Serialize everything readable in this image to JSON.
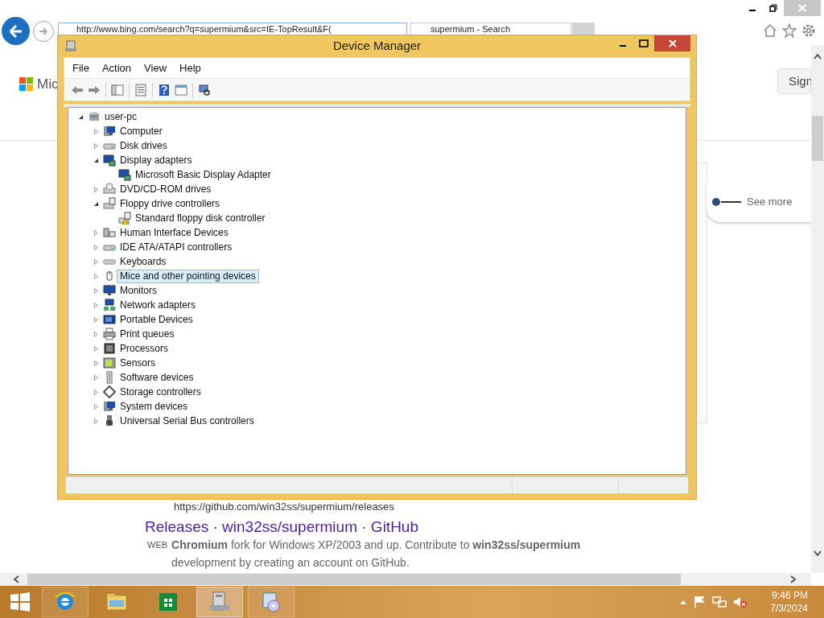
{
  "browser": {
    "address": "http://www.bing.com/search?q=supermium&src=IE-TopResult&F(",
    "tab_title": "supermium - Search",
    "logo_text": "Mic",
    "sign_in": "Sign",
    "card_link": "See more",
    "result": {
      "url": "https://github.com/win32ss/supermium/releases",
      "title": "Releases · win32ss/supermium · GitHub",
      "source_label": "WEB",
      "snippet": "**Chromium** fork for Windows XP/2003 and up. Contribute to **win32ss/supermium** development by creating an account on GitHub."
    }
  },
  "device_manager": {
    "title": "Device Manager",
    "menu": [
      "File",
      "Action",
      "View",
      "Help"
    ],
    "tree": {
      "label": "user-pc",
      "kind": "computer-root",
      "expanded": true,
      "selected": false,
      "children": [
        {
          "label": "Computer",
          "kind": "computer",
          "expanded": false,
          "selected": false
        },
        {
          "label": "Disk drives",
          "kind": "disk",
          "expanded": false,
          "selected": false
        },
        {
          "label": "Display adapters",
          "kind": "display",
          "expanded": true,
          "selected": false,
          "children": [
            {
              "label": "Microsoft Basic Display Adapter",
              "kind": "display",
              "selected": false
            }
          ]
        },
        {
          "label": "DVD/CD-ROM drives",
          "kind": "dvd",
          "expanded": false,
          "selected": false
        },
        {
          "label": "Floppy drive controllers",
          "kind": "floppy",
          "expanded": true,
          "selected": false,
          "children": [
            {
              "label": "Standard floppy disk controller",
              "kind": "floppy-warning",
              "selected": false
            }
          ]
        },
        {
          "label": "Human Interface Devices",
          "kind": "hid",
          "expanded": false,
          "selected": false
        },
        {
          "label": "IDE ATA/ATAPI controllers",
          "kind": "disk",
          "expanded": false,
          "selected": false
        },
        {
          "label": "Keyboards",
          "kind": "keyboard",
          "expanded": false,
          "selected": false
        },
        {
          "label": "Mice and other pointing devices",
          "kind": "mouse",
          "expanded": false,
          "selected": true
        },
        {
          "label": "Monitors",
          "kind": "monitor",
          "expanded": false,
          "selected": false
        },
        {
          "label": "Network adapters",
          "kind": "network",
          "expanded": false,
          "selected": false
        },
        {
          "label": "Portable Devices",
          "kind": "portable",
          "expanded": false,
          "selected": false
        },
        {
          "label": "Print queues",
          "kind": "printer",
          "expanded": false,
          "selected": false
        },
        {
          "label": "Processors",
          "kind": "chip",
          "expanded": false,
          "selected": false
        },
        {
          "label": "Sensors",
          "kind": "sensor",
          "expanded": false,
          "selected": false
        },
        {
          "label": "Software devices",
          "kind": "software",
          "expanded": false,
          "selected": false
        },
        {
          "label": "Storage controllers",
          "kind": "storage",
          "expanded": false,
          "selected": false
        },
        {
          "label": "System devices",
          "kind": "computer",
          "expanded": false,
          "selected": false
        },
        {
          "label": "Universal Serial Bus controllers",
          "kind": "usb",
          "expanded": false,
          "selected": false
        }
      ]
    }
  },
  "taskbar": {
    "apps": [
      {
        "kind": "browser",
        "selected": false
      },
      {
        "kind": "folder",
        "selected": false
      },
      {
        "kind": "store",
        "selected": false
      },
      {
        "kind": "device-manager",
        "selected": true
      },
      {
        "kind": "setup",
        "selected": false
      }
    ],
    "time": "9:46 PM",
    "date": "7/3/2024"
  }
}
